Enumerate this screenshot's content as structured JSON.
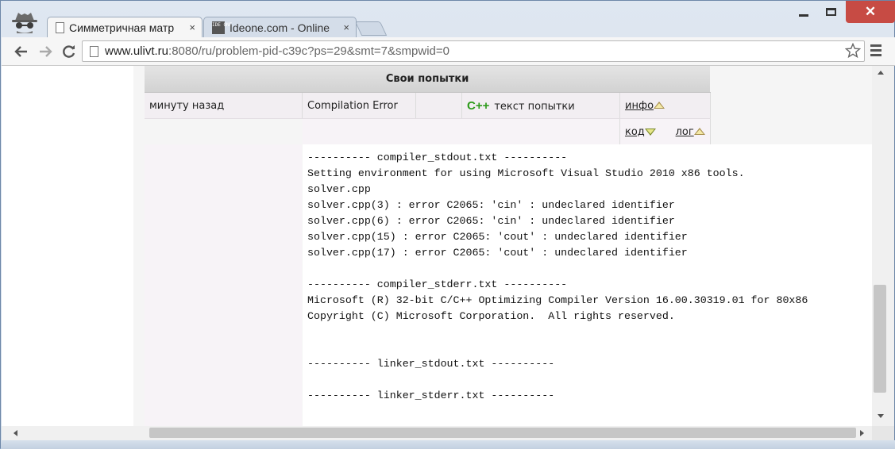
{
  "browser": {
    "tabs": [
      {
        "title": "Симметричная матр",
        "icon": "document-icon",
        "active": true
      },
      {
        "title": "Ideone.com - Online",
        "icon": "ideone-icon",
        "active": false
      }
    ],
    "close_glyph": "×",
    "ideone_icon_text": "IDE ONE",
    "url": {
      "host": "www.ulivt.ru",
      "rest": ":8080/ru/problem-pid-c39c?ps=29&smt=7&smpwid=0"
    },
    "close_window_glyph": "✕",
    "accent_close": "#c74b44"
  },
  "attempts": {
    "header": "Свои попытки",
    "row": {
      "time": "минуту назад",
      "status": "Compilation Error",
      "empty": "",
      "language_logo": "C++",
      "view_text": "текст попытки",
      "info_link": "инфо"
    },
    "row2": {
      "code_link": "код",
      "log_link": "лог"
    }
  },
  "log": {
    "text": "---------- compiler_stdout.txt ----------\nSetting environment for using Microsoft Visual Studio 2010 x86 tools.\nsolver.cpp\nsolver.cpp(3) : error C2065: 'cin' : undeclared identifier\nsolver.cpp(6) : error C2065: 'cin' : undeclared identifier\nsolver.cpp(15) : error C2065: 'cout' : undeclared identifier\nsolver.cpp(17) : error C2065: 'cout' : undeclared identifier\n\n---------- compiler_stderr.txt ----------\nMicrosoft (R) 32-bit C/C++ Optimizing Compiler Version 16.00.30319.01 for 80x86\nCopyright (C) Microsoft Corporation.  All rights reserved.\n\n\n---------- linker_stdout.txt ----------\n\n---------- linker_stderr.txt ----------"
  }
}
